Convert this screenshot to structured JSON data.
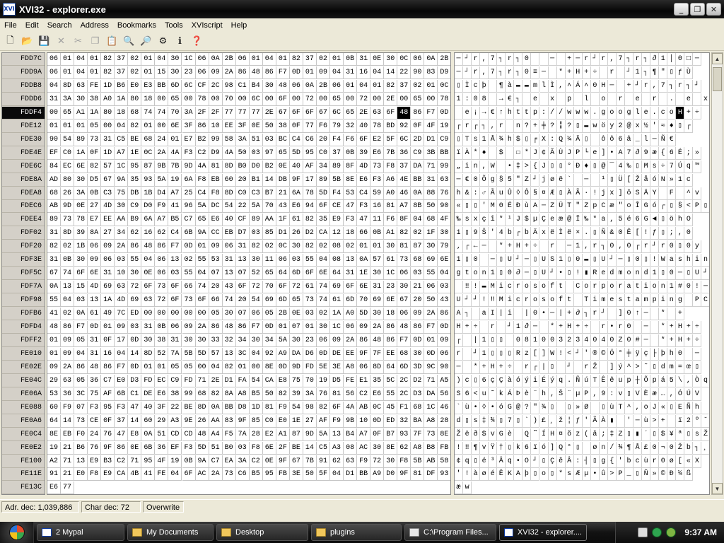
{
  "window": {
    "app_icon_text": "XVI\n32",
    "title": "XVI32 - explorer.exe"
  },
  "menu": [
    "File",
    "Edit",
    "Search",
    "Address",
    "Bookmarks",
    "Tools",
    "XVIscript",
    "Help"
  ],
  "toolbar_icons": [
    {
      "name": "new-file-icon",
      "glyph": "🗋",
      "enabled": true
    },
    {
      "name": "open-folder-icon",
      "glyph": "📂",
      "enabled": true
    },
    {
      "name": "save-icon",
      "glyph": "💾",
      "enabled": true
    },
    {
      "name": "close-file-icon",
      "glyph": "✕",
      "enabled": false
    },
    {
      "name": "cut-icon",
      "glyph": "✂",
      "enabled": false
    },
    {
      "name": "copy-icon",
      "glyph": "❐",
      "enabled": false
    },
    {
      "name": "paste-icon",
      "glyph": "📋",
      "enabled": true
    },
    {
      "name": "find-icon",
      "glyph": "🔍",
      "enabled": true
    },
    {
      "name": "find-replace-icon",
      "glyph": "🔎",
      "enabled": true
    },
    {
      "name": "settings-icon",
      "glyph": "⚙",
      "enabled": true
    },
    {
      "name": "info-icon",
      "glyph": "ℹ",
      "enabled": true
    },
    {
      "name": "help-icon",
      "glyph": "❓",
      "enabled": true
    }
  ],
  "hex_view": {
    "addresses": [
      "FDD7C",
      "FDD9A",
      "FDDB8",
      "FDDD6",
      "FDDF4",
      "FDE12",
      "FDE30",
      "FDE4E",
      "FDE6C",
      "FDE8A",
      "FDEA8",
      "FDEC6",
      "FDEE4",
      "FDF02",
      "FDF20",
      "FDF3E",
      "FDF5C",
      "FDF7A",
      "FDF98",
      "FDFB6",
      "FDFD4",
      "FDFF2",
      "FE010",
      "FE02E",
      "FE04C",
      "FE06A",
      "FE088",
      "FE0A6",
      "FE0C4",
      "FE0E2",
      "FE100",
      "FE11E",
      "FE13C"
    ],
    "current_row": 4,
    "selected_col": 26,
    "rows": [
      "06 01 04 01 82 37 02 01 04 30 1C 06 0A 2B 06 01 04 01 82 37 02 01 0B 31 0E 30 0C 06 0A 2B",
      "06 01 04 01 82 37 02 01 15 30 23 06 09 2A 86 48 86 F7 0D 01 09 04 31 16 04 14 22 90 83 D9",
      "04 8D 63 FE 1D B6 E0 E3 BB 6D 6C CF 2C 98 C1 B4 30 48 06 0A 2B 06 01 04 01 82 37 02 01 0C",
      "31 3A 30 38 A0 1A 80 18 00 65 00 78 00 70 00 6C 00 6F 00 72 00 65 00 72 00 2E 00 65 00 78",
      "00 65 A1 1A 80 18 68 74 74 70 3A 2F 2F 77 77 77 2E 67 6F 6F 67 6C 65 2E 63 6F 48 86 F7 0D",
      "01 01 01 05 00 04 82 01 00 6E 3F 86 10 EE 3F 0E 50 38 0F 77 F6 79 32 40 78 BD 92 0F 4F 19",
      "90 54 89 73 31 C5 BE 68 24 01 E7 B2 99 58 3A 51 03 BC C4 C6 20 F4 F6 6F E2 5F 6C 2D D1 C9",
      "EF C0 1A 0F 1D A7 1E 0C 2A 4A F3 C2 D9 4A 50 03 97 65 5D 95 C0 37 0B 39 E6 7B 36 C9 3B BB",
      "84 EC 6E 82 57 1C 95 87 9B 7B 9D 4A 81 8D B0 D0 B2 0E 40 AF 34 89 8F 4D 73 F8 37 DA 71 99",
      "AD 80 30 D5 67 9A 35 93 5A 19 6A F8 EB 60 20 B1 14 DB 9F 17 89 5B 8E E6 F3 A6 4E BB 31 63",
      "68 26 3A 0B C3 75 DB 1B D4 A7 25 C4 F8 8D C0 C3 B7 21 6A 78 5D F4 53 C4 59 A0 46 0A 88 76",
      "AB 9D 0E 27 4D 30 C9 D0 F9 41 96 5A DC 54 22 5A 70 43 E6 94 6F CE 47 F3 16 81 A7 8B 50 90",
      "89 73 78 E7 EE AA B9 6A A7 B5 C7 65 E6 40 CF 89 AA 1F 61 82 35 E9 F3 47 11 F6 8F 04 68 4F",
      "31 8D 39 8A 27 34 62 16 62 C4 6B 9A CC EB D7 03 85 D1 26 D2 CA 12 18 66 0B A1 82 02 1F 30",
      "82 02 1B 06 09 2A 86 48 86 F7 0D 01 09 06 31 82 02 0C 30 82 02 08 02 01 01 30 81 87 30 79",
      "31 0B 30 09 06 03 55 04 06 13 02 55 53 31 13 30 11 06 03 55 04 08 13 0A 57 61 73 68 69 6E",
      "67 74 6F 6E 31 10 30 0E 06 03 55 04 07 13 07 52 65 64 6D 6F 6E 64 31 1E 30 1C 06 03 55 04",
      "0A 13 15 4D 69 63 72 6F 73 6F 66 74 20 43 6F 72 70 6F 72 61 74 69 6F 6E 31 23 30 21 06 03",
      "55 04 03 13 1A 4D 69 63 72 6F 73 6F 66 74 20 54 69 6D 65 73 74 61 6D 70 69 6E 67 20 50 43",
      "41 02 0A 61 49 7C ED 00 00 00 00 00 05 30 07 06 05 2B 0E 03 02 1A A0 5D 30 18 06 09 2A 86",
      "48 86 F7 0D 01 09 03 31 0B 06 09 2A 86 48 86 F7 0D 01 07 01 30 1C 06 09 2A 86 48 86 F7 0D",
      "01 09 05 31 0F 17 0D 30 38 31 30 30 33 32 34 30 34 5A 30 23 06 09 2A 86 48 86 F7 0D 01 09",
      "01 09 04 31 16 04 14 8D 52 7A 5B 5D 57 13 3C 04 92 A9 DA D6 0D DE EE 9F 7F EE 68 30 0D 06",
      "09 2A 86 48 86 F7 0D 01 01 05 05 00 04 82 01 00 8E 0D 9D FD 5E 3E A8 06 8D 64 6D 3D 9C 90",
      "29 63 05 36 C7 E0 D3 FD EC C9 FD 71 2E D1 FA 54 CA E8 75 70 19 D5 FE E1 35 5C 2C D2 71 A5",
      "53 36 3C 75 AF 6B C1 DE E6 38 99 68 82 8A A8 B5 50 82 39 3A 76 81 56 C2 E6 55 2C D3 DA 56",
      "60 F9 07 F3 95 F3 47 40 3F 22 BE 8D 0A BB D8 1D 81 F9 54 98 82 6F 4A AB 0C 45 F1 68 1C 46",
      "64 14 73 CE 0F 37 14 60 29 A3 9E 26 AA 83 9F 85 C0 E0 1E 27 AF F9 9B 10 0D ED 32 BA A8 28",
      "8E EB F0 24 76 47 E8 0A 51 CD CD 48 A4 F5 7A 28 E2 A1 87 9D 5A 13 B4 A7 0F B7 93 7F 73 8E",
      "19 21 B6 76 9F 86 0E 6B 36 EF F3 5D 51 B0 03 F8 6E 2F BE 14 C5 A3 08 AC 30 8E 62 A8 B8 FB",
      "A2 71 13 E9 B3 C2 71 95 4F 19 0B 9A C7 EA 3A C2 0E 9F 67 7B 91 62 63 F9 72 30 F8 5B AB 58",
      "91 21 E0 F8 E9 CA 4B 41 FE 04 6F AC 2A 73 C6 B5 95 FB 3E 50 5F 04 D1 BB A9 D0 9F 81 DF 93",
      "E6 77"
    ],
    "chars": [
      "─┘r,7┐r┐0  ─ +─r┘r,7┐r┐∂1│0□─",
      "─┘r,7┐r┐0≡─ *+H+÷ r ┘1┐¶\"▯ƒÙ",
      "▯Ìcþ ¶à▬▬mlÌ,˄Á˄0H─ +┘r,7┐r┐┘",
      "1:08 →€┐ e x p l o r e r . e x",
      " e¡→€↑http://www.google.coH+÷",
      "┌r┌┐,r n?+╪?╏?▯▬wöy2@x½'≈♦▯┌",
      "▯Ts1Å¾h$▯╒X:Q¼Ä▯ ôô6â_l─Ñ€",
      "ïÀ*♦ $ ☐*J¢ÃÙJP└e]•A7∂9æ{6É;»",
      "„in,W •‡>{J▯▯°Ð♦▯@¯4‰▯Ms÷7Úq™",
      "─€0Õg§5\"Z┘jøë` ─ ¹▯Ü[ŽåóN»1c",
      "h&:♂ÃuÛ◊Ô§¤Æ▯ÀÃ·!jx]ôSÄY F ^v",
      "«▯▯'M0ÉÐùA─ZÜT\"ZpCæ\"oÎGó┌▯§<P▯",
      "‰sxçî*¹J$µÇeæ@Ï‰*a,5é6G◄▯öhO",
      "1▯9Š'4b┌bÄxëÌë×.▯Ñ&0Ê[!ƒ▯;,0",
      "‚┌←─ *+H+÷ r ─1,r┐0,0┌r┘r0▯0y",
      "1▯0 ─▯U┘─▯US1▯0▬▯U┘─▯0▯!Washin",
      "gton1▯0∂─▯U┘•▯!▮Redmond1▯0─▯U┘",
      " ‼!▬Microsoft Corporation1#0!─",
      "U┘┘!‼Microsoft Timestamping PC",
      "A┐ aI|i |0•─|+∂┐r┘ ]0↑─ * +",
      "H+÷ r ┘1∂─ *+H+÷ r•r0 ─ *+H+÷",
      "┌ |1▯▯ 081003234040Z0#─ *+H+÷",
      "r ┘1▯▯▯Rz[]W!<┘'®©Ö°╪ÿç├þh0 ─",
      "─ *+H+÷ r┌|▯ ┘ rŽ ]ý^>˜▯dm=œ▯",
      ")c▯6çÇàóýiÉýq.ÑúTÊêup┼Õpá5\\,Òq¥",
      "S6<u˜kÁÞè¨h,Š¨µP,9:v▯VÈæ…,ÓÚV",
      "`ù•◊•óG@?\"¾▯ ▯»Ø ▯ùT^,oJ«▯EÑh F",
      "d▯s‡¾▯7▯`)£¸ž¦ƒ'ÃÀ▮ '─ù>+ ï2º˘",
      "Žëð$vGè Q͆ÍH¤õz(â;‡Z▯▮´▯$¥ª▯sŽ",
      "!‼¶vŸ†▯k6ïó]Q°▯ øn/¾¶Å£0¬0Žb┐¸û",
      "¢q▯é³Âq•O┘▯ÇêÂ:┤▯g{'bcùr0ø[«X",
      "'!àøéÊKAþ▯o▯*sÆµ•û>P_▯Ñ»©Ð¼ß",
      "æw"
    ]
  },
  "scrollbar": {
    "up": "▲",
    "down": "▼"
  },
  "status": {
    "address": "Adr. dec: 1,039,886",
    "char": "Char dec: 72",
    "mode": "Overwrite"
  },
  "taskbar": {
    "tasks": [
      {
        "label": "2 Mypal",
        "icon": "app"
      },
      {
        "label": "My Documents",
        "icon": "folder"
      },
      {
        "label": "Desktop",
        "icon": "folder"
      },
      {
        "label": "plugins",
        "icon": "folder"
      },
      {
        "label": "C:\\Program Files...",
        "icon": "doc"
      },
      {
        "label": "XVI32 - explorer....",
        "icon": "app"
      }
    ],
    "active_task": 5,
    "clock": "9:37 AM"
  }
}
